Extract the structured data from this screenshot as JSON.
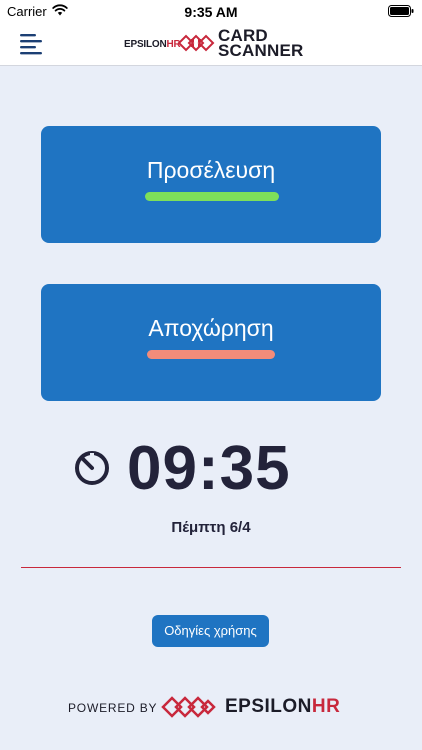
{
  "status_bar": {
    "carrier": "Carrier",
    "time": "9:35 AM",
    "wifi_icon": "wifi-icon",
    "battery_icon": "battery-icon"
  },
  "header": {
    "menu_icon": "menu-icon",
    "brand_small_prefix": "EPSILON",
    "brand_small_suffix": "HR",
    "brand_line1": "CARD",
    "brand_line2": "SCANNER"
  },
  "actions": {
    "checkin_label": "Προσέλευση",
    "checkout_label": "Αποχώρηση"
  },
  "clock": {
    "icon": "timer-icon",
    "time": "09:35",
    "date": "Πέμπτη 6/4"
  },
  "help": {
    "label": "Οδηγίες χρήσης"
  },
  "footer": {
    "powered_by": "POWERED BY",
    "brand_prefix": "EPSILON",
    "brand_suffix": "HR"
  },
  "colors": {
    "background": "#e9eef8",
    "primary": "#1f74c2",
    "accent_red": "#c8283c",
    "checkin_green": "#7ee05a",
    "checkout_salmon": "#f28c7a",
    "text_dark": "#23233a"
  }
}
